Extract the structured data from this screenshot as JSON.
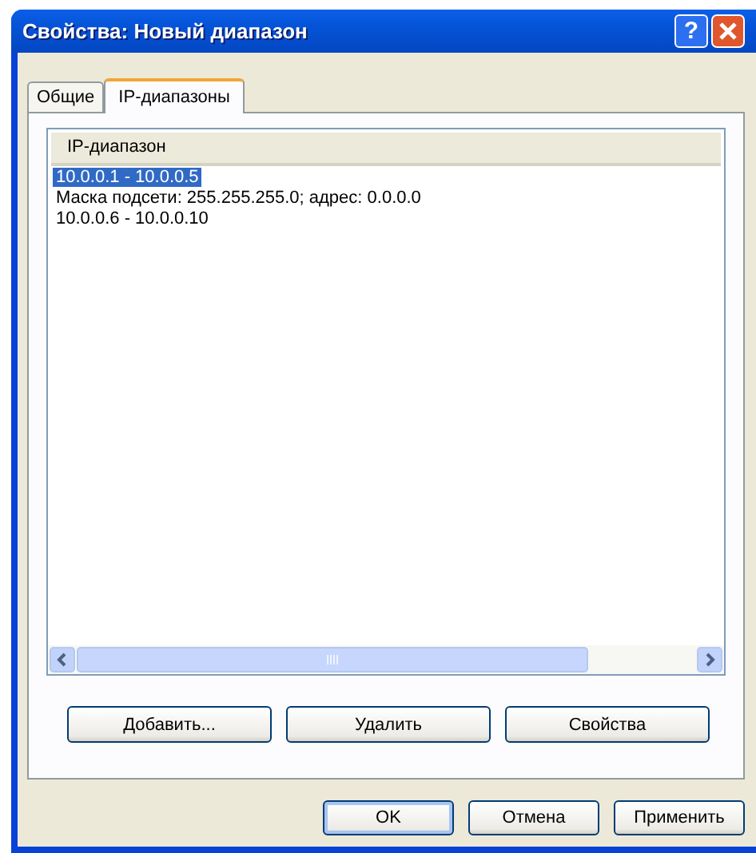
{
  "window": {
    "title": "Свойства: Новый диапазон",
    "title_buttons": [
      "?"
    ]
  },
  "tabs": [
    {
      "label": "Общие",
      "selected": false
    },
    {
      "label": "IP-диапазоны",
      "selected": true
    }
  ],
  "list": {
    "column": "IP-диапазон",
    "rows": [
      {
        "text": "10.0.0.1 - 10.0.0.5",
        "selected": true
      },
      {
        "text": "Маска подсети: 255.255.255.0; адрес: 0.0.0.0",
        "selected": false
      },
      {
        "text": "10.0.0.6 - 10.0.0.10",
        "selected": false
      }
    ]
  },
  "panel_buttons": [
    "Добавить...",
    "Удалить",
    "Свойства"
  ],
  "dialog_buttons": [
    {
      "label": "OK",
      "default": true
    },
    {
      "label": "Отмена",
      "default": false
    },
    {
      "label": "Применить",
      "default": false
    }
  ]
}
